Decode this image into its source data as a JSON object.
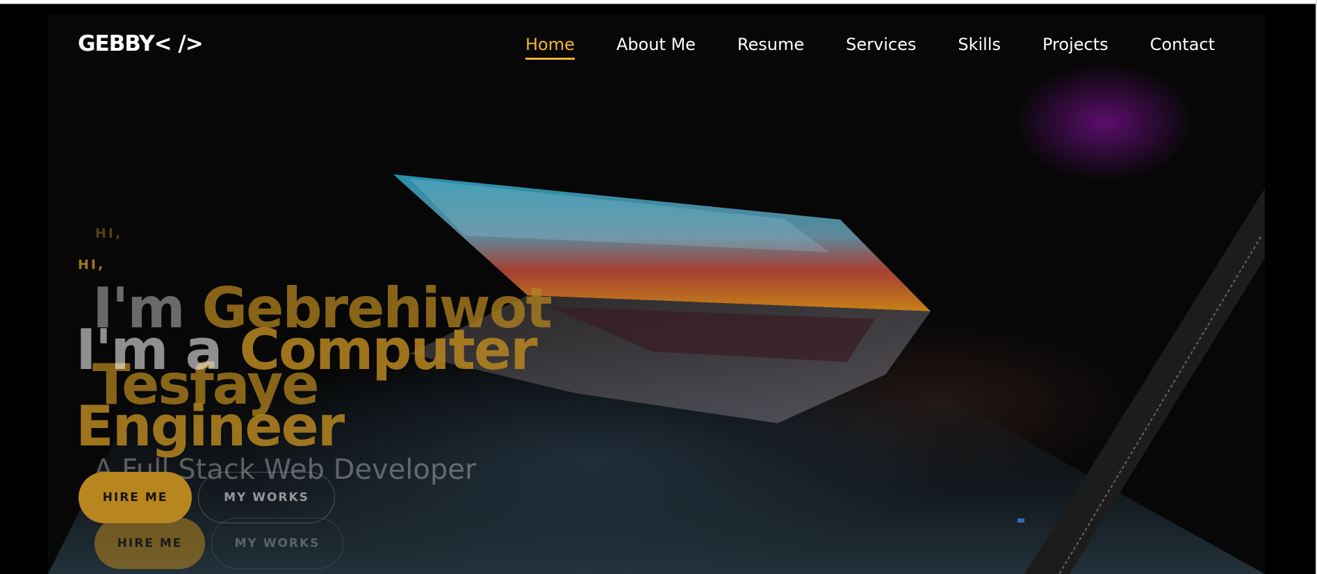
{
  "header": {
    "logo": "GEBBY< />",
    "nav": [
      {
        "label": "Home",
        "active": true
      },
      {
        "label": "About Me",
        "active": false
      },
      {
        "label": "Resume",
        "active": false
      },
      {
        "label": "Services",
        "active": false
      },
      {
        "label": "Skills",
        "active": false
      },
      {
        "label": "Projects",
        "active": false
      },
      {
        "label": "Contact",
        "active": false
      }
    ]
  },
  "hero_background": {
    "greeting": "HI,",
    "name_prefix": "I'm",
    "name": "Gebrehiwot Tesfaye",
    "subtitle": "A Full Stack Web Developer",
    "hire_button": "HIRE ME",
    "works_button": "MY WORKS"
  },
  "hero_foreground": {
    "greeting": "HI,",
    "title_prefix": "I'm a",
    "title": "Computer Engineer",
    "hire_button": "HIRE ME",
    "works_button": "MY WORKS"
  },
  "colors": {
    "accent": "#f5b32e",
    "accent_dark": "#b8861e",
    "background": "#070707",
    "nav_text": "#ffffff"
  },
  "icons": {
    "hero_image": "laptop-photo"
  }
}
